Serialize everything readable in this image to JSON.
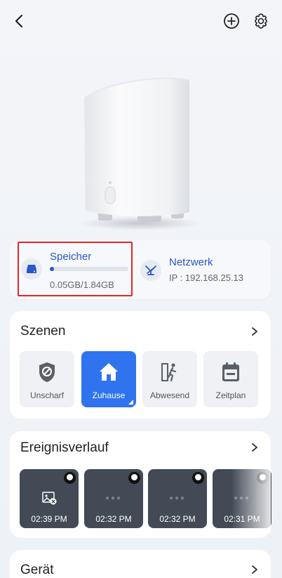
{
  "header": {
    "back_icon": "chevron-left-icon",
    "add_icon": "plus-circle-icon",
    "settings_icon": "gear-icon"
  },
  "storage": {
    "title": "Speicher",
    "value": "0.05GB/1.84GB",
    "used_fraction": 0.027,
    "icon": "drive-icon"
  },
  "network": {
    "title": "Netzwerk",
    "ip": "IP : 192.168.25.13",
    "icon": "network-icon"
  },
  "scenes": {
    "title": "Szenen",
    "items": [
      {
        "label": "Unscharf",
        "icon": "shield-off-icon",
        "active": false
      },
      {
        "label": "Zuhause",
        "icon": "home-icon",
        "active": true
      },
      {
        "label": "Abwesend",
        "icon": "walk-out-icon",
        "active": false
      },
      {
        "label": "Zeitplan",
        "icon": "calendar-icon",
        "active": false
      }
    ]
  },
  "events": {
    "title": "Ereignisverlauf",
    "items": [
      {
        "time": "02:39 PM"
      },
      {
        "time": "02:32 PM"
      },
      {
        "time": "02:32 PM"
      },
      {
        "time": "02:31 PM"
      }
    ]
  },
  "device": {
    "title": "Gerät"
  },
  "colors": {
    "accent": "#2f74ee",
    "link": "#2a57c9",
    "highlight_border": "#e0262a"
  }
}
